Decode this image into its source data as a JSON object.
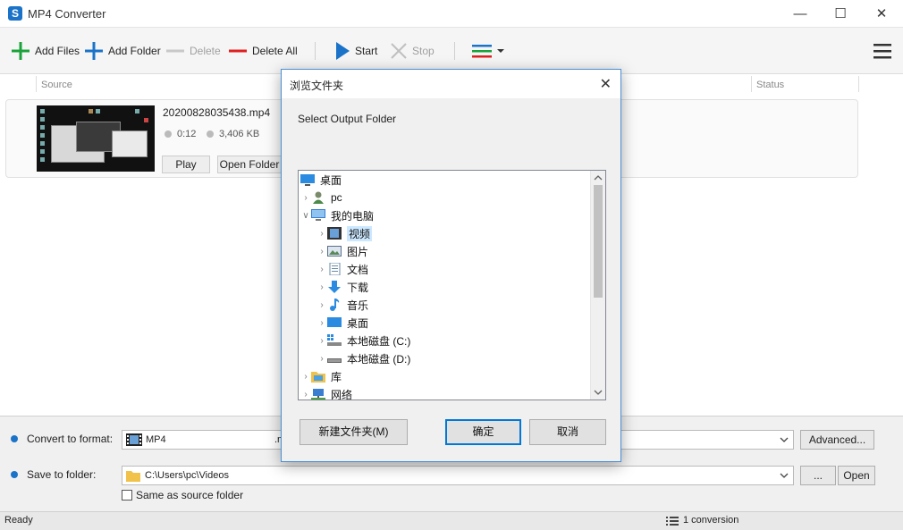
{
  "window": {
    "title": "MP4 Converter",
    "minimize": "—",
    "maximize": "☐",
    "close": "✕"
  },
  "toolbar": {
    "add_files": "Add Files",
    "add_folder": "Add Folder",
    "delete": "Delete",
    "delete_all": "Delete All",
    "start": "Start",
    "stop": "Stop"
  },
  "list": {
    "col_source": "Source",
    "col_status": "Status",
    "file": {
      "name": "20200828035438.mp4",
      "duration": "0:12",
      "size": "3,406 KB",
      "play": "Play",
      "open_folder": "Open Folder"
    }
  },
  "bottom": {
    "format_label": "Convert to format:",
    "format_value": "MP4",
    "format_partial": ".m",
    "advanced": "Advanced...",
    "folder_label": "Save to folder:",
    "folder_value": "C:\\Users\\pc\\Videos",
    "browse": "...",
    "open": "Open",
    "same_as_source": "Same as source folder"
  },
  "status": {
    "left": "Ready",
    "right": "1 conversion"
  },
  "dialog": {
    "title": "浏览文件夹",
    "close": "✕",
    "message": "Select Output Folder",
    "tree": [
      {
        "label": "桌面"
      },
      {
        "label": "pc"
      },
      {
        "label": "我的电脑"
      },
      {
        "label": "视频"
      },
      {
        "label": "图片"
      },
      {
        "label": "文档"
      },
      {
        "label": "下载"
      },
      {
        "label": "音乐"
      },
      {
        "label": "桌面"
      },
      {
        "label": "本地磁盘 (C:)"
      },
      {
        "label": "本地磁盘 (D:)"
      },
      {
        "label": "库"
      },
      {
        "label": "网络"
      }
    ],
    "new_folder": "新建文件夹(M)",
    "ok": "确定",
    "cancel": "取消"
  },
  "colors": {
    "accent": "#1a73c8",
    "green": "#1aa33a",
    "red": "#e02020",
    "selection": "#cce8ff"
  }
}
